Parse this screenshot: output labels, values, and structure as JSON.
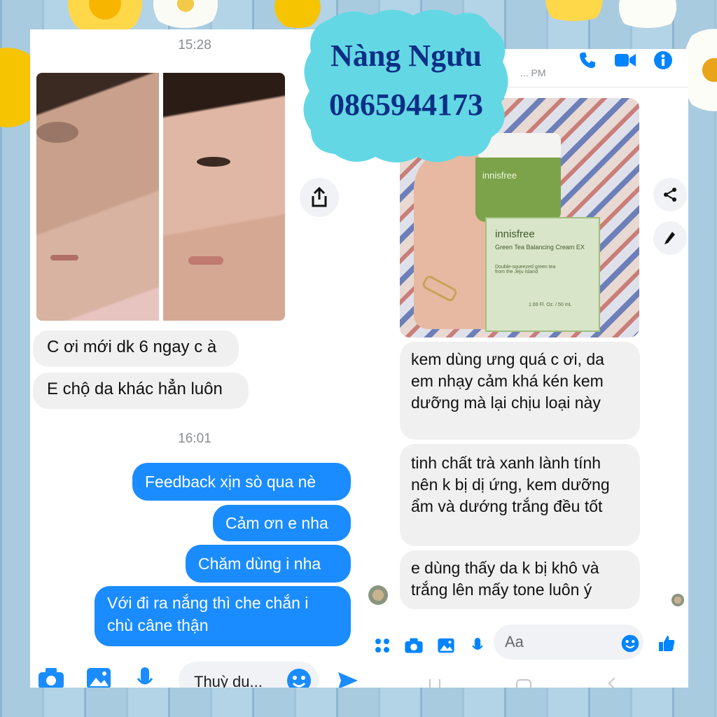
{
  "colors": {
    "messenger_blue": "#1a8cff",
    "badge_bg": "#63d8e4",
    "badge_text": "#0c2f86",
    "incoming_bubble": "#f0f0f0",
    "icon_blue": "#0084ff"
  },
  "watermark": {
    "name": "Nàng Ngưu",
    "phone": "0865944173"
  },
  "left_chat": {
    "time_1": "15:28",
    "incoming": [
      "C ơi mới dk 6 ngay c à",
      "E chộ da khác hẳn luôn"
    ],
    "time_2": "16:01",
    "outgoing": [
      "Feedback xịn sò qua nè",
      "Cảm ơn e nha",
      "Chăm dùng i nha",
      "Với đi ra nắng thì che chắn i chù câne thận"
    ],
    "composer": {
      "input_value": "Thuỳ dụ...",
      "icons": [
        "camera-icon",
        "gallery-icon",
        "microphone-icon",
        "emoji-icon",
        "send-icon"
      ]
    },
    "share_icon": "share-icon"
  },
  "right_chat": {
    "header_partial": "... PM",
    "header_icons": [
      "phone-icon",
      "video-icon",
      "info-icon"
    ],
    "product_photo": {
      "brand": "innisfree",
      "product": "Green Tea Balancing Cream EX",
      "tagline": "Double-squeezed green tea from the Jeju Island",
      "volume": "1.69 Fl. Oz. / 50 mL"
    },
    "incoming": [
      "kem dùng ưng quá c ơi, da em nhạy cảm khá kén kem dưỡng mà lại chịu loại này",
      "tinh chất trà xanh lành tính nên k bị dị ứng, kem dưỡng ẩm và dướng trắng đều tốt",
      "e dùng thấy da k bị khô và trắng lên mấy tone luôn ý"
    ],
    "composer": {
      "placeholder": "Aa",
      "icons": [
        "apps-icon",
        "camera-icon",
        "gallery-icon",
        "microphone-icon",
        "emoji-icon",
        "like-icon"
      ]
    },
    "side_icons": [
      "share-icon",
      "edit-icon"
    ]
  }
}
